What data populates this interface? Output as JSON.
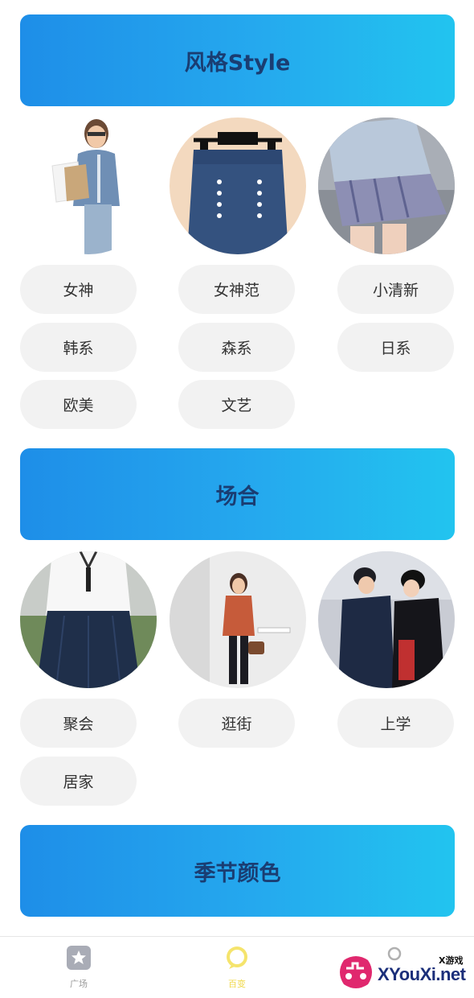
{
  "sections": [
    {
      "title": "风格Style",
      "tags": [
        "女神",
        "女神范",
        "小清新",
        "韩系",
        "森系",
        "日系",
        "欧美",
        "文艺"
      ]
    },
    {
      "title": "场合",
      "tags": [
        "聚会",
        "逛街",
        "上学",
        "居家"
      ]
    },
    {
      "title": "季节颜色"
    }
  ],
  "tabbar": {
    "items": [
      {
        "label": "广场",
        "icon": "star-icon",
        "active": false
      },
      {
        "label": "百变",
        "icon": "chat-bubble-icon",
        "active": true
      },
      {
        "label": "",
        "icon": "profile-icon",
        "active": false
      }
    ]
  },
  "watermark": {
    "small": "X游戏",
    "text": "XYouXi.net"
  },
  "colors": {
    "banner_start": "#1e8ee8",
    "banner_end": "#22c4ef",
    "banner_text": "#1a3d72",
    "tag_bg": "#f2f2f2",
    "active_tab": "#f0d94a"
  }
}
